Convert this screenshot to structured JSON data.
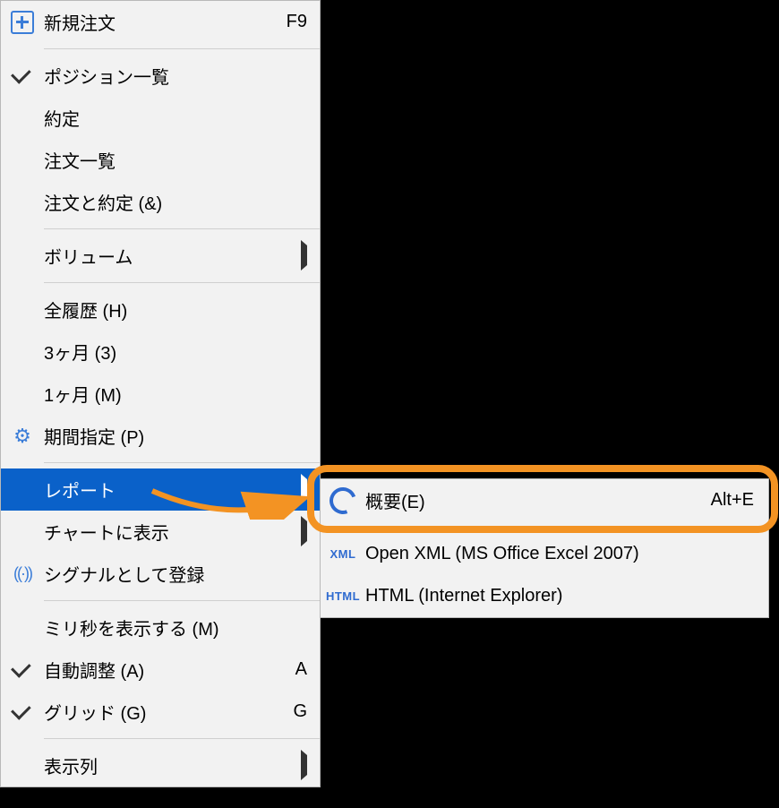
{
  "main_menu": {
    "new_order": {
      "label": "新規注文",
      "shortcut": "F9"
    },
    "positions": {
      "label": "ポジション一覧"
    },
    "fills": {
      "label": "約定"
    },
    "orders": {
      "label": "注文一覧"
    },
    "orders_fills": {
      "label": "注文と約定 (&)"
    },
    "volume": {
      "label": "ボリューム"
    },
    "all_history": {
      "label": "全履歴 (H)"
    },
    "three_months": {
      "label": "3ヶ月 (3)"
    },
    "one_month": {
      "label": "1ヶ月 (M)"
    },
    "custom_period": {
      "label": "期間指定 (P)"
    },
    "report": {
      "label": "レポート"
    },
    "show_on_chart": {
      "label": "チャートに表示"
    },
    "register_signal": {
      "label": "シグナルとして登録"
    },
    "show_ms": {
      "label": "ミリ秒を表示する (M)"
    },
    "auto_adjust": {
      "label": "自動調整 (A)",
      "shortcut": "A"
    },
    "grid": {
      "label": "グリッド (G)",
      "shortcut": "G"
    },
    "columns": {
      "label": "表示列"
    }
  },
  "sub_menu": {
    "summary": {
      "label": "概要(E)",
      "shortcut": "Alt+E",
      "icon": "chart-icon"
    },
    "open_xml": {
      "label": "Open XML (MS Office Excel 2007)",
      "icon_text": "XML"
    },
    "html": {
      "label": "HTML (Internet Explorer)",
      "icon_text": "HTML"
    }
  }
}
